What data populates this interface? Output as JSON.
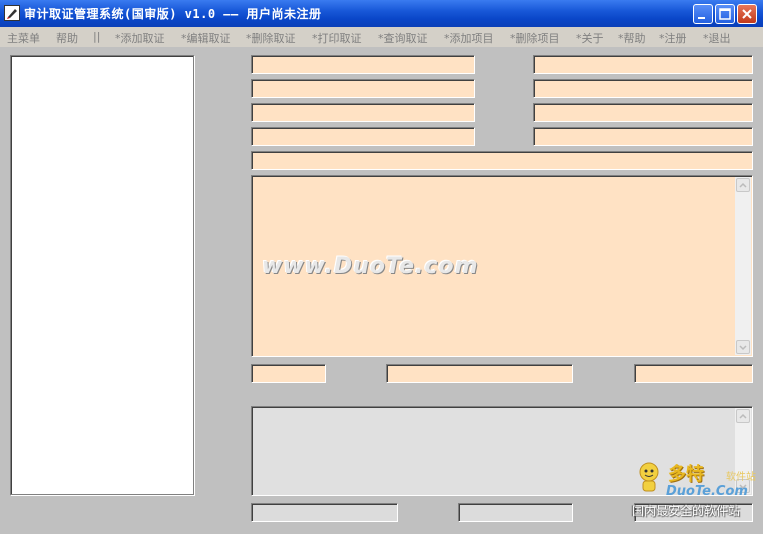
{
  "window": {
    "title": "审计取证管理系统(国审版) v1.0 —— 用户尚未注册"
  },
  "menu": {
    "items": [
      "主菜单",
      "帮助",
      "||",
      "*添加取证",
      "*编辑取证",
      "*删除取证",
      "*打印取证",
      "*查询取证",
      "*添加项目",
      "*删除项目",
      "*关于",
      "*帮助",
      "*注册",
      "*退出"
    ]
  },
  "watermark": {
    "text": "www.DuoTe.com"
  },
  "logo": {
    "title": "多特",
    "small": "软件站",
    "en": "DuoTe.Com",
    "sub": "国内最安全的软件站"
  },
  "colors": {
    "field_bg": "#ffe2c4",
    "title_bar": "#0a46c8",
    "window_bg": "#c0c0c0"
  }
}
